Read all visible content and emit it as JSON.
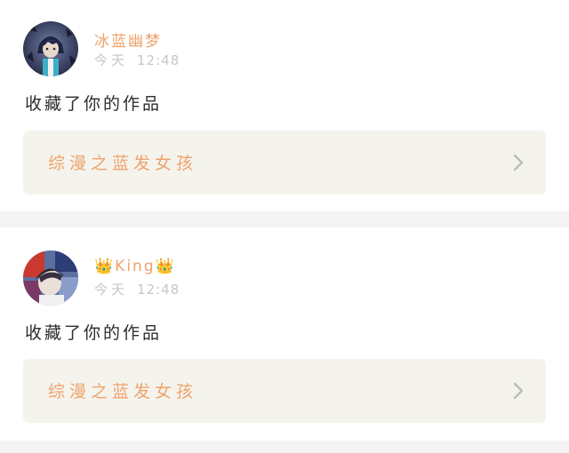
{
  "colors": {
    "username": "#f0a26c",
    "work_title": "#f0a26c",
    "timestamp": "#c6c6c6",
    "action_text": "#2c2c2c",
    "link_background": "#f4f4ed",
    "separator": "#f5f4f4"
  },
  "notifications": [
    {
      "username": "冰蓝幽梦",
      "time_day": "今天",
      "time_clock": "12:48",
      "action": "收藏了你的作品",
      "work_title": "综漫之蓝发女孩",
      "chevron_icon": "chevron-right-icon"
    },
    {
      "username": "👑King👑",
      "time_day": "今天",
      "time_clock": "12:48",
      "action": "收藏了你的作品",
      "work_title": "综漫之蓝发女孩",
      "chevron_icon": "chevron-right-icon"
    }
  ]
}
